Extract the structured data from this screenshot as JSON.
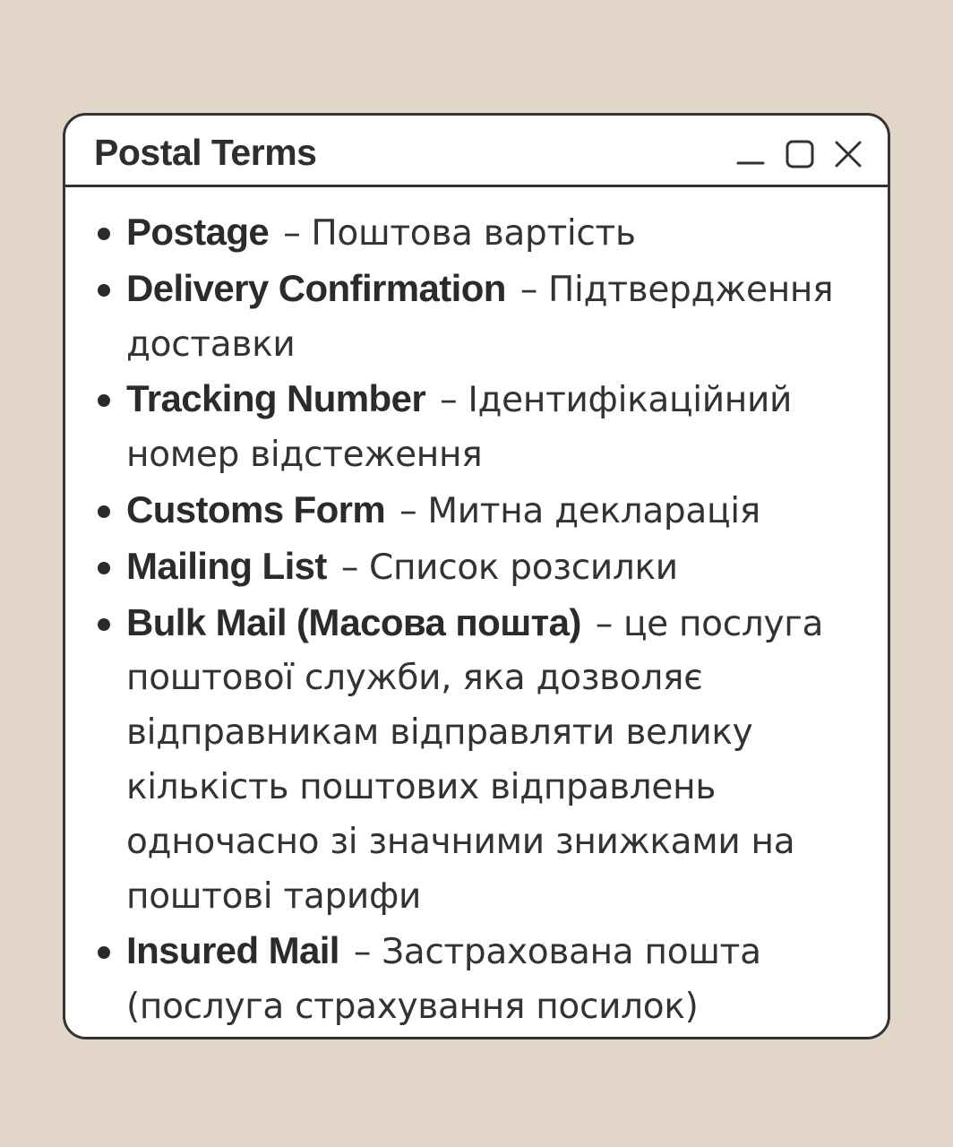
{
  "window": {
    "title": "Postal Terms",
    "controls": [
      "minimize-icon",
      "maximize-icon",
      "close-icon"
    ]
  },
  "terms": [
    {
      "term": "Postage",
      "dash": "–",
      "definition": "Поштова вартість"
    },
    {
      "term": "Delivery Confirmation",
      "dash": "–",
      "definition": "Підтвердження доставки"
    },
    {
      "term": "Tracking Number",
      "dash": "–",
      "definition": "Ідентифікаційний номер відстеження"
    },
    {
      "term": "Customs Form",
      "dash": "–",
      "definition": "Митна декларація"
    },
    {
      "term": "Mailing List",
      "dash": "–",
      "definition": "Список розсилки"
    },
    {
      "term": "Bulk Mail (Масова пошта)",
      "dash": "–",
      "definition": "це послуга поштової служби, яка дозволяє відправникам відправляти велику кількість поштових відправлень одночасно зі значними знижками на поштові тарифи"
    },
    {
      "term": "Insured Mail",
      "dash": "–",
      "definition": "Застрахована пошта (послуга страхування посилок)"
    }
  ],
  "colors": {
    "background": "#e2d6c8",
    "window": "#ffffff",
    "border": "#333333",
    "text": "#2b2b2b"
  }
}
